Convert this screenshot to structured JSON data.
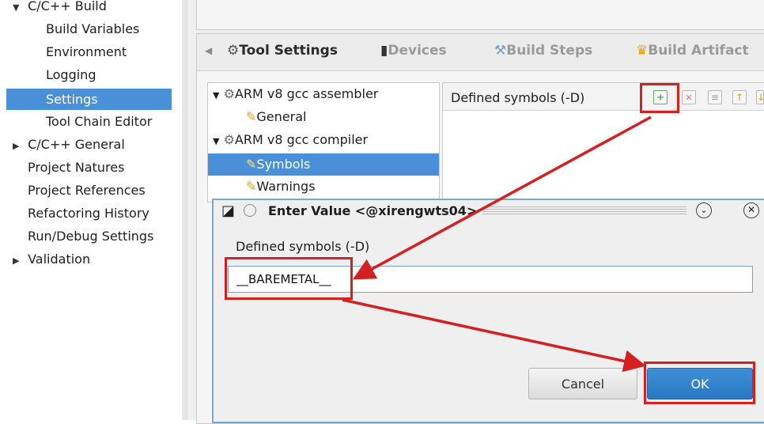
{
  "sidebar": {
    "items": [
      {
        "label": "C/C++ Build",
        "expander": "▼"
      },
      {
        "label": "Build Variables"
      },
      {
        "label": "Environment"
      },
      {
        "label": "Logging"
      },
      {
        "label": "Settings"
      },
      {
        "label": "Tool Chain Editor"
      },
      {
        "label": "C/C++ General",
        "expander": "▶"
      },
      {
        "label": "Project Natures"
      },
      {
        "label": "Project References"
      },
      {
        "label": "Refactoring History"
      },
      {
        "label": "Run/Debug Settings"
      },
      {
        "label": "Validation",
        "expander": "▶"
      }
    ]
  },
  "tabs": [
    {
      "label": "Tool Settings",
      "icon": "gear-icon"
    },
    {
      "label": "Devices",
      "icon": "chip-icon"
    },
    {
      "label": "Build Steps",
      "icon": "wand-icon"
    },
    {
      "label": "Build Artifact",
      "icon": "trophy-icon"
    }
  ],
  "tool_tree": {
    "items": [
      {
        "label": "ARM v8 gcc assembler",
        "expander": "▼"
      },
      {
        "label": "General"
      },
      {
        "label": "ARM v8 gcc compiler",
        "expander": "▼"
      },
      {
        "label": "Symbols"
      },
      {
        "label": "Warnings"
      }
    ]
  },
  "symbols_panel": {
    "title": "Defined symbols (-D)"
  },
  "dialog": {
    "title": "Enter Value  <@xirengwts04>",
    "field_label": "Defined symbols (-D)",
    "value": "__BAREMETAL__",
    "cancel_label": "Cancel",
    "ok_label": "OK",
    "minimize_glyph": "⌄",
    "close_glyph": "✕"
  },
  "colors": {
    "selection": "#4a90d9",
    "annotation": "#d42020",
    "ok_button": "#2a78c4"
  }
}
